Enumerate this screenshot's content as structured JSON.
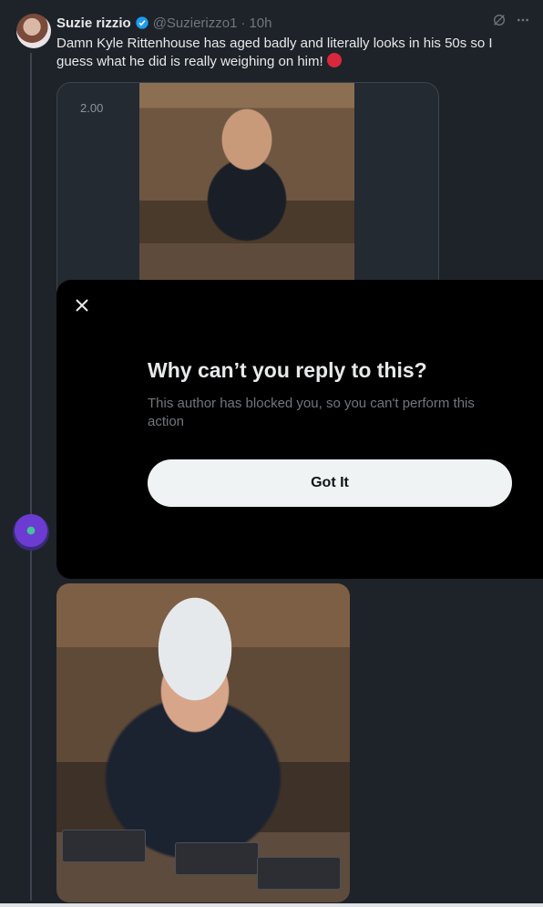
{
  "tweet": {
    "name": "Suzie rizzio",
    "handle": "@Suzierizzo1",
    "separator": "·",
    "time": "10h",
    "text": "Damn Kyle Rittenhouse has aged badly and literally looks in his 50s so I guess what he did is really weighing on him!",
    "media_label": "2.00",
    "icons": {
      "grok": "grok-icon",
      "more": "more-icon",
      "verified": "verified-badge-icon",
      "emoji": "angry-face-emoji"
    }
  },
  "dialog": {
    "title": "Why can’t you reply to this?",
    "description": "This author has blocked you, so you can't perform this action",
    "button_label": "Got It",
    "icons": {
      "close": "close-icon"
    }
  },
  "colors": {
    "background": "#1e2329",
    "overlay": "#000000",
    "text_primary": "#e7e9ea",
    "text_secondary": "#71767b",
    "verified": "#1d9bf0",
    "button_bg": "#eff3f4"
  }
}
